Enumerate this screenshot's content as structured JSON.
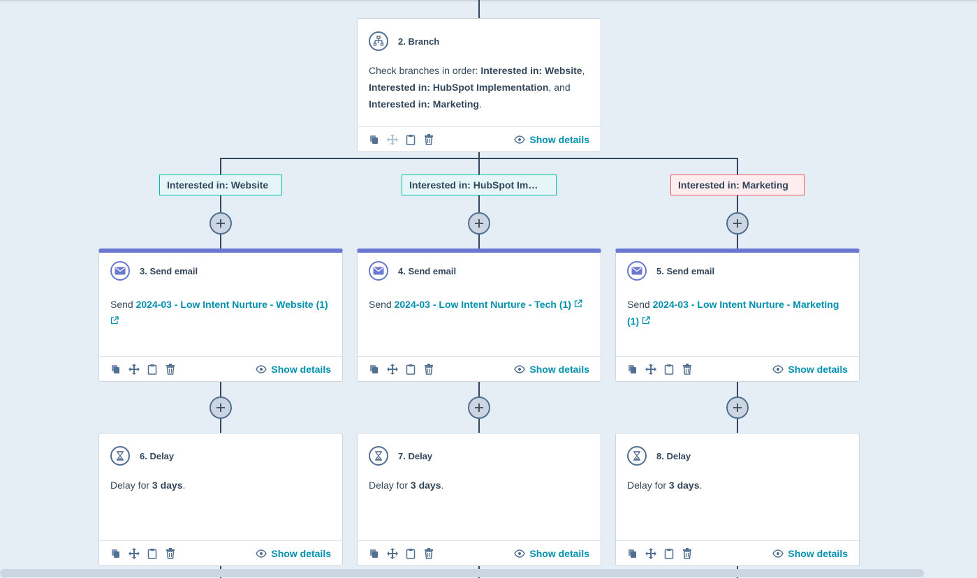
{
  "branch_card": {
    "title": "2. Branch",
    "body_prefix": "Check branches in order: ",
    "b1": "Interested in: Website",
    "sep1": ", ",
    "b2": "Interested in: HubSpot Implementation",
    "sep2": ", and ",
    "b3": "Interested in: Marketing",
    "suffix": ".",
    "show_details": "Show details"
  },
  "branches": [
    {
      "label": "Interested in: Website"
    },
    {
      "label": "Interested in: HubSpot Im…"
    },
    {
      "label": "Interested in: Marketing"
    }
  ],
  "email_cards": [
    {
      "title": "3. Send email",
      "prefix": "Send ",
      "link": "2024-03 - Low Intent Nurture - Website (1)",
      "show_details": "Show details"
    },
    {
      "title": "4. Send email",
      "prefix": "Send ",
      "link": "2024-03 - Low Intent Nurture - Tech (1)",
      "show_details": "Show details"
    },
    {
      "title": "5. Send email",
      "prefix": "Send ",
      "link": "2024-03 - Low Intent Nurture - Marketing (1)",
      "show_details": "Show details"
    }
  ],
  "delay_cards": [
    {
      "title": "6. Delay",
      "prefix": "Delay for ",
      "value": "3 days",
      "suffix": ".",
      "show_details": "Show details"
    },
    {
      "title": "7. Delay",
      "prefix": "Delay for ",
      "value": "3 days",
      "suffix": ".",
      "show_details": "Show details"
    },
    {
      "title": "8. Delay",
      "prefix": "Delay for ",
      "value": "3 days",
      "suffix": ".",
      "show_details": "Show details"
    }
  ],
  "icons": {
    "branch": "branch-icon",
    "email": "email-icon",
    "delay": "hourglass-icon",
    "clone": "clone-icon",
    "move": "move-icon",
    "paste": "clipboard-icon",
    "delete": "trash-icon",
    "view": "eye-icon",
    "external": "external-link-icon",
    "add": "plus-icon"
  },
  "colors": {
    "background": "#e5edf5",
    "link": "#0091ae",
    "email_accent": "#6a78d1",
    "branch_teal": "#00bda5",
    "branch_red": "#f2545b",
    "text": "#33475b"
  }
}
